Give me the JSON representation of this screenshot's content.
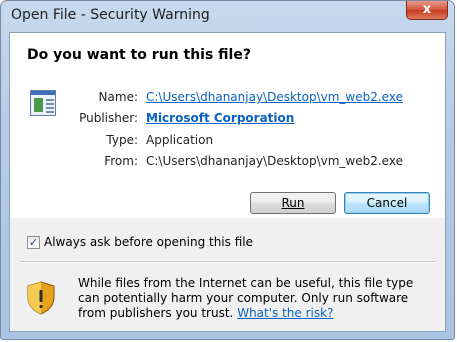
{
  "window": {
    "title": "Open File - Security Warning",
    "close_glyph": "x"
  },
  "dialog": {
    "question": "Do you want to run this file?",
    "file_icon": "application-file-icon",
    "rows": {
      "name": {
        "label": "Name:",
        "value": "C:\\Users\\dhananjay\\Desktop\\vm_web2.exe"
      },
      "publisher": {
        "label": "Publisher:",
        "value": "Microsoft Corporation"
      },
      "type": {
        "label": "Type:",
        "value": "Application"
      },
      "from": {
        "label": "From:",
        "value": "C:\\Users\\dhananjay\\Desktop\\vm_web2.exe"
      }
    },
    "buttons": {
      "run": "Run",
      "cancel": "Cancel"
    },
    "always_ask": {
      "label": "Always ask before opening this file",
      "checked": true
    },
    "warning": {
      "icon": "security-shield-icon",
      "text": "While files from the Internet can be useful, this file type can potentially harm your computer. Only run software from publishers you trust.",
      "link": "What's the risk?"
    }
  },
  "colors": {
    "link": "#0b61c4",
    "default_button_border": "#3c7fb1",
    "title_close": "#c43a1e"
  }
}
